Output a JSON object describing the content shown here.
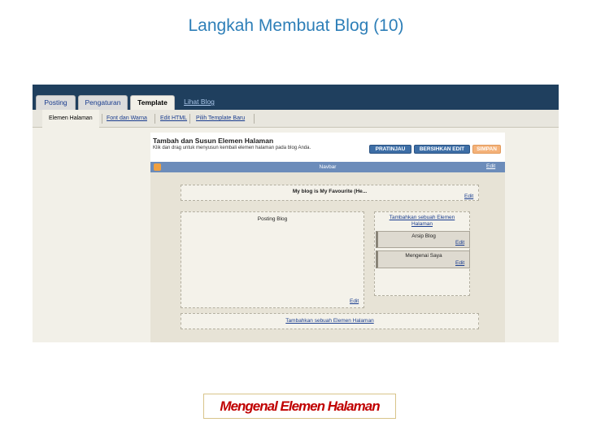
{
  "slide": {
    "title": "Langkah Membuat Blog (10)",
    "caption": "Mengenal Elemen Halaman"
  },
  "tabs": [
    "Posting",
    "Pengaturan",
    "Template",
    "Lihat Blog"
  ],
  "active_tab": "Template",
  "subtabs": [
    "Elemen Halaman",
    "Font dan Warna",
    "Edit HTML",
    "Pilih Template Baru"
  ],
  "active_subtab": "Elemen Halaman",
  "canvas": {
    "heading": "Tambah dan Susun Elemen Halaman",
    "subheading": "Klik dan drag untuk menyusun kembali elemen halaman pada blog Anda.",
    "buttons": {
      "preview": "PRATINJAU",
      "clear": "BERSIHKAN EDIT",
      "save": "SIMPAN"
    }
  },
  "layout": {
    "navbar_label": "Navbar",
    "header_title": "My blog is My Favourite (He...",
    "posts_label": "Posting Blog",
    "sidebar_add_link": "Tambahkan sebuah Elemen Halaman",
    "archive_label": "Arsip Blog",
    "about_label": "Mengenai Saya",
    "footer_add_link": "Tambahkan sebuah Elemen Halaman",
    "edit_label": "Edit"
  },
  "colors": {
    "title": "#2e7fb8",
    "tabbar": "#1f3f5e",
    "navbar": "#6c8cba",
    "button_blue": "#3d6ea6",
    "button_orange": "#f4b27a",
    "caption_text": "#c00000"
  },
  "icons": {
    "navbar": "blogger-icon"
  }
}
